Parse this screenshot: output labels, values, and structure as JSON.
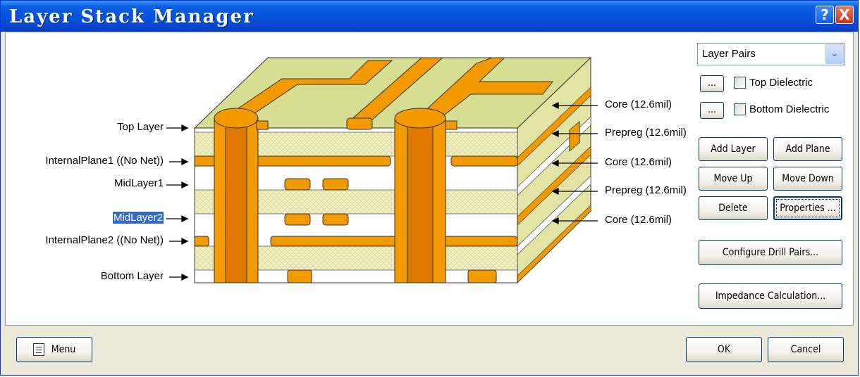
{
  "window": {
    "title": "Layer Stack Manager",
    "help_glyph": "?",
    "close_glyph": "X"
  },
  "left_labels": [
    {
      "text": "Top Layer",
      "selected": false
    },
    {
      "text": "InternalPlane1 ((No Net))",
      "selected": false
    },
    {
      "text": "MidLayer1",
      "selected": false
    },
    {
      "text": "MidLayer2",
      "selected": true
    },
    {
      "text": "InternalPlane2 ((No Net))",
      "selected": false
    },
    {
      "text": "Bottom Layer",
      "selected": false
    }
  ],
  "right_labels": [
    "Core (12.6mil)",
    "Prepreg (12.6mil)",
    "Core (12.6mil)",
    "Prepreg (12.6mil)",
    "Core (12.6mil)"
  ],
  "panel": {
    "layer_mode_value": "Layer Pairs",
    "dropdown_glyph": "⌄",
    "ellipsis": "...",
    "top_dielectric_label": "Top Dielectric",
    "top_dielectric_checked": false,
    "bottom_dielectric_label": "Bottom Dielectric",
    "bottom_dielectric_checked": false,
    "add_layer": "Add Layer",
    "add_plane": "Add Plane",
    "move_up": "Move Up",
    "move_down": "Move Down",
    "delete": "Delete",
    "properties": "Properties ...",
    "configure_drill_pairs": "Configure Drill Pairs...",
    "impedance_calculation": "Impedance Calculation..."
  },
  "footer": {
    "menu": "Menu",
    "ok": "OK",
    "cancel": "Cancel"
  },
  "colors": {
    "copper": "#f29a00",
    "dielectric": "#f2efc2",
    "core": "#e8e6a8",
    "top_face": "#d7de92",
    "title_blue": "#0a5fe0"
  }
}
